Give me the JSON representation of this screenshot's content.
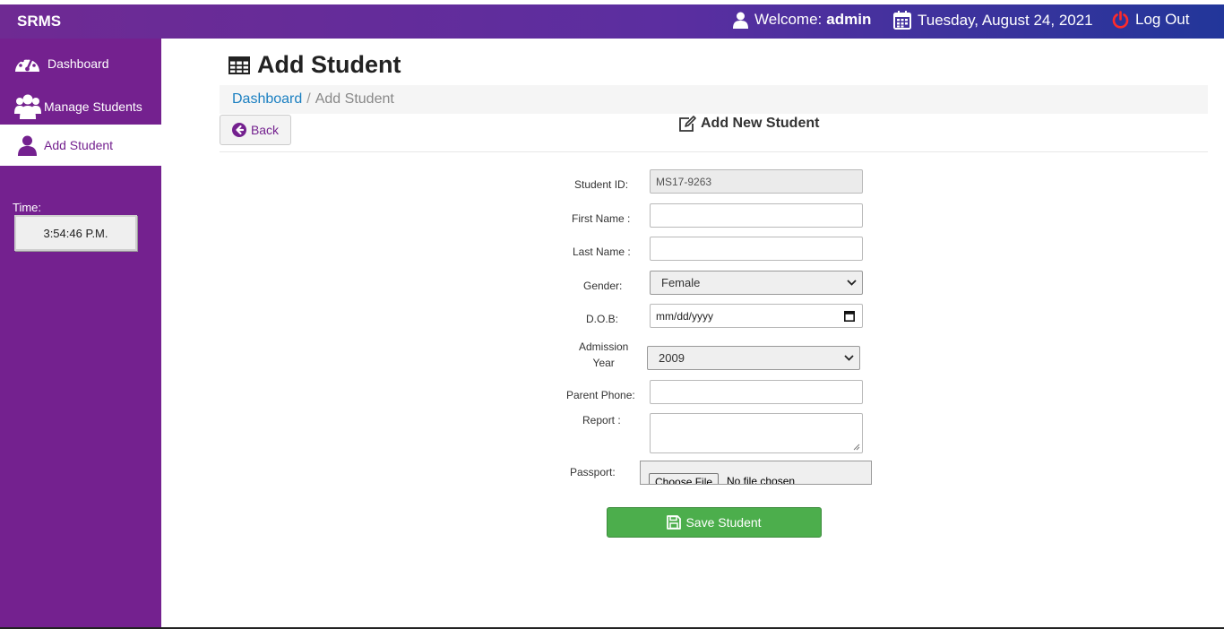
{
  "topbar": {
    "brand": "SRMS",
    "welcome_prefix": "Welcome:",
    "welcome_user": "admin",
    "date": "Tuesday, August 24, 2021",
    "logout": "Log Out"
  },
  "sidebar": {
    "items": [
      {
        "label": "Dashboard",
        "icon": "dashboard-gauge-icon",
        "active": false
      },
      {
        "label": "Manage Students",
        "icon": "users-icon",
        "active": false
      },
      {
        "label": "Add Student",
        "icon": "user-icon",
        "active": true
      }
    ],
    "time_label": "Time:",
    "time_value": "3:54:46 P.M."
  },
  "main": {
    "title": "Add Student",
    "breadcrumb": {
      "link": "Dashboard",
      "separator": "/",
      "current": "Add Student"
    },
    "back_label": "Back",
    "form_title": "Add New Student"
  },
  "form": {
    "student_id": {
      "label": "Student ID:",
      "value": "MS17-9263"
    },
    "first_name": {
      "label": "First Name :",
      "value": ""
    },
    "last_name": {
      "label": "Last Name :",
      "value": ""
    },
    "gender": {
      "label": "Gender:",
      "value": "Female"
    },
    "dob": {
      "label": "D.O.B:",
      "placeholder": "mm/dd/yyyy"
    },
    "admission_year": {
      "label_line1": "Admission",
      "label_line2": "Year",
      "value": "2009"
    },
    "parent_phone": {
      "label": "Parent Phone:",
      "value": ""
    },
    "report": {
      "label": "Report :",
      "value": ""
    },
    "passport": {
      "label": "Passport:",
      "button": "Choose File",
      "status": "No file chosen"
    },
    "save_label": "Save Student"
  },
  "colors": {
    "sidebar": "#74218f",
    "save": "#4cae4c",
    "link": "#1a7fc1",
    "logout_icon": "#ff2a2a"
  }
}
